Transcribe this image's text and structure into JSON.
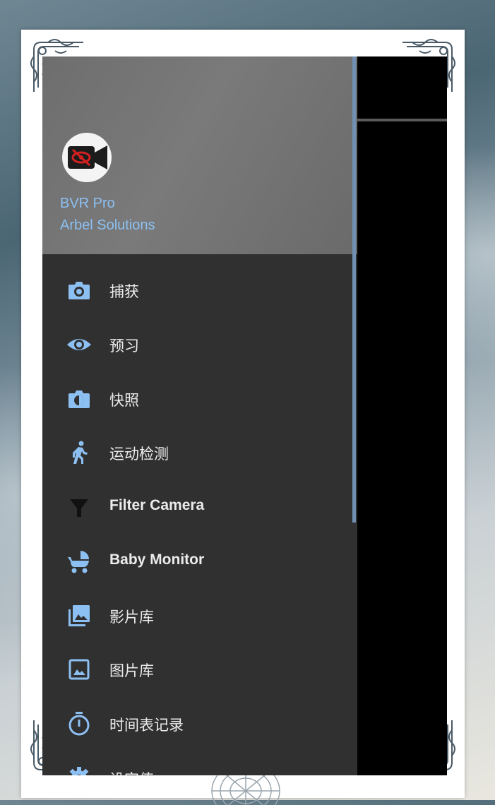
{
  "drawer": {
    "app_name": "BVR Pro",
    "company": "Arbel Solutions",
    "items": [
      {
        "label": "捕获",
        "icon": "camera-icon"
      },
      {
        "label": "预习",
        "icon": "eye-icon"
      },
      {
        "label": "快照",
        "icon": "snapshot-icon"
      },
      {
        "label": "运动检测",
        "icon": "running-person-icon"
      },
      {
        "label": "Filter Camera",
        "icon": "filter-funnel-icon"
      },
      {
        "label": "Baby Monitor",
        "icon": "baby-stroller-icon"
      },
      {
        "label": "影片库",
        "icon": "video-library-icon"
      },
      {
        "label": "图片库",
        "icon": "image-icon"
      },
      {
        "label": "时间表记录",
        "icon": "timer-icon"
      },
      {
        "label": "设定值",
        "icon": "gear-icon"
      }
    ]
  },
  "colors": {
    "accent": "#8dc0f2",
    "drawer_bg": "#303030",
    "header_bg": "#737373",
    "logo_red": "#d32020"
  }
}
